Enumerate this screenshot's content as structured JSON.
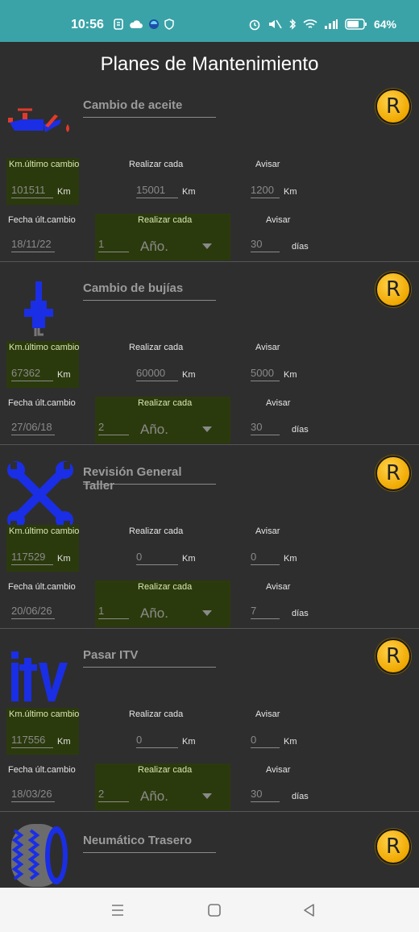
{
  "status": {
    "time": "10:56",
    "battery": "64%"
  },
  "title": "Planes de Mantenimiento",
  "sections": [
    {
      "name": "Cambio de aceite",
      "icon": "oil-can-icon",
      "km_label": "Km.último cambio",
      "km_value": "101511",
      "unit_km": "Km",
      "realizar_label": "Realizar cada",
      "realizar_km": "15001",
      "avisar_label": "Avisar",
      "avisar_km": "1200",
      "fecha_label": "Fecha últ.cambio",
      "fecha_value": "18/11/22",
      "realizar_n": "1",
      "periodo": "Año.",
      "avisar_dias": "30",
      "dias": "días",
      "r": "R"
    },
    {
      "name": "Cambio de bujías",
      "icon": "spark-plug-icon",
      "km_label": "Km.último cambio",
      "km_value": "67362",
      "unit_km": "Km",
      "realizar_label": "Realizar cada",
      "realizar_km": "60000",
      "avisar_label": "Avisar",
      "avisar_km": "5000",
      "fecha_label": "Fecha últ.cambio",
      "fecha_value": "27/06/18",
      "realizar_n": "2",
      "periodo": "Año.",
      "avisar_dias": "30",
      "dias": "días",
      "r": "R"
    },
    {
      "name": "Revisión General Taller",
      "icon": "wrenches-icon",
      "km_label": "Km.último cambio",
      "km_value": "117529",
      "unit_km": "Km",
      "realizar_label": "Realizar cada",
      "realizar_km": "0",
      "avisar_label": "Avisar",
      "avisar_km": "0",
      "fecha_label": "Fecha últ.cambio",
      "fecha_value": "20/06/26",
      "realizar_n": "1",
      "periodo": "Año.",
      "avisar_dias": "7",
      "dias": "días",
      "r": "R"
    },
    {
      "name": "Pasar ITV",
      "icon": "itv-logo-icon",
      "km_label": "Km.último cambio",
      "km_value": "117556",
      "unit_km": "Km",
      "realizar_label": "Realizar cada",
      "realizar_km": "0",
      "avisar_label": "Avisar",
      "avisar_km": "0",
      "fecha_label": "Fecha últ.cambio",
      "fecha_value": "18/03/26",
      "realizar_n": "2",
      "periodo": "Año.",
      "avisar_dias": "30",
      "dias": "días",
      "r": "R"
    },
    {
      "name": "Neumático Trasero",
      "icon": "tire-icon",
      "r": "R"
    }
  ],
  "colors": {
    "statusbar": "#3aa3a8",
    "background": "#2e2e2e",
    "green_box": "#2b3a0c",
    "accent_blue": "#1a2ee6",
    "r_button": "#f0a800"
  }
}
